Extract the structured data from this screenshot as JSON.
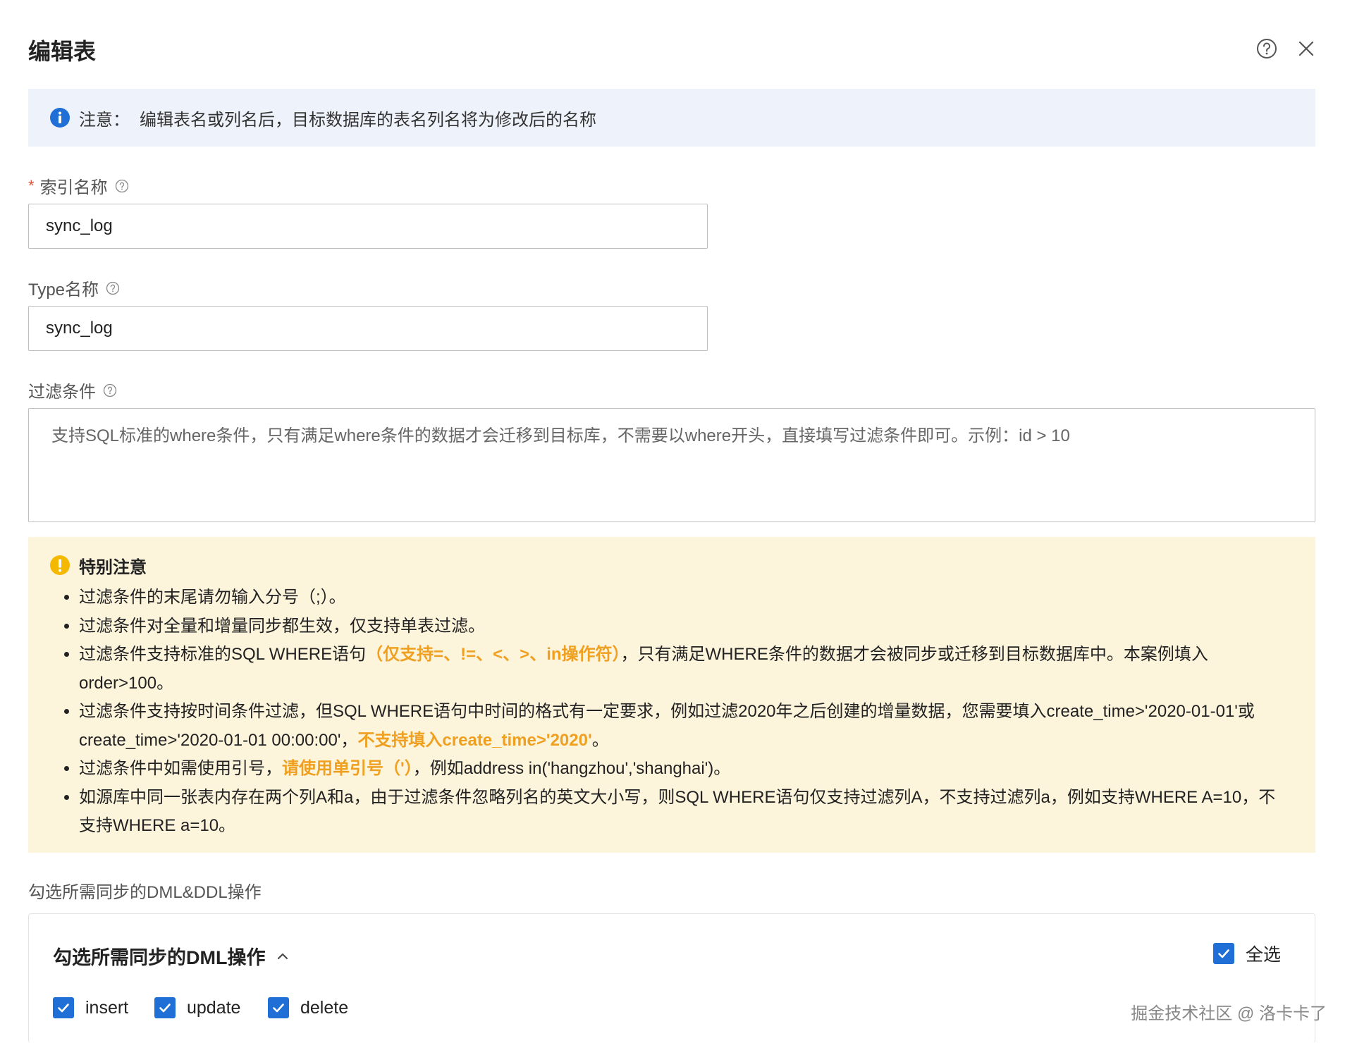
{
  "dialog": {
    "title": "编辑表",
    "help_icon": "question-circle-icon",
    "close_icon": "close-icon"
  },
  "notice": {
    "icon": "info-circle-icon",
    "label": "注意：",
    "text": "编辑表名或列名后，目标数据库的表名列名将为修改后的名称",
    "icon_color": "#1f6fd6"
  },
  "form": {
    "index_name": {
      "label": "索引名称",
      "required": "*",
      "value": "sync_log"
    },
    "type_name": {
      "label": "Type名称",
      "value": "sync_log"
    },
    "filter": {
      "label": "过滤条件",
      "placeholder": "支持SQL标准的where条件，只有满足where条件的数据才会迁移到目标库，不需要以where开头，直接填写过滤条件即可。示例：id > 10"
    }
  },
  "warning": {
    "icon": "warning-circle-icon",
    "title": "特别注意",
    "items": [
      {
        "a": "过滤条件的末尾请勿输入分号（;）。"
      },
      {
        "a": "过滤条件对全量和增量同步都生效，仅支持单表过滤。"
      },
      {
        "a": "过滤条件支持标准的SQL WHERE语句",
        "hl": "（仅支持=、!=、<、>、in操作符）",
        "b": "，只有满足WHERE条件的数据才会被同步或迁移到目标数据库中。本案例填入order>100。"
      },
      {
        "a": "过滤条件支持按时间条件过滤，但SQL WHERE语句中时间的格式有一定要求，例如过滤2020年之后创建的增量数据，您需要填入create_time>'2020-01-01'或create_time>'2020-01-01 00:00:00'，",
        "hl": "不支持填入create_time>'2020'",
        "b": "。"
      },
      {
        "a": "过滤条件中如需使用引号，",
        "hl": "请使用单引号（'）",
        "b": "，例如address in('hangzhou','shanghai')。"
      },
      {
        "a": "如源库中同一张表内存在两个列A和a，由于过滤条件忽略列名的英文大小写，则SQL WHERE语句仅支持过滤列A，不支持过滤列a，例如支持WHERE A=10，不支持WHERE a=10。"
      }
    ],
    "bg_color": "#fdf4dc",
    "highlight_color": "#f0a020"
  },
  "dml": {
    "section_label": "勾选所需同步的DML&DDL操作",
    "panel_title": "勾选所需同步的DML操作",
    "select_all": {
      "label": "全选",
      "checked": true
    },
    "options": [
      {
        "label": "insert",
        "checked": true
      },
      {
        "label": "update",
        "checked": true
      },
      {
        "label": "delete",
        "checked": true
      }
    ],
    "checkbox_color": "#1f6fd6"
  },
  "watermark": "掘金技术社区 @ 洛卡卡了"
}
